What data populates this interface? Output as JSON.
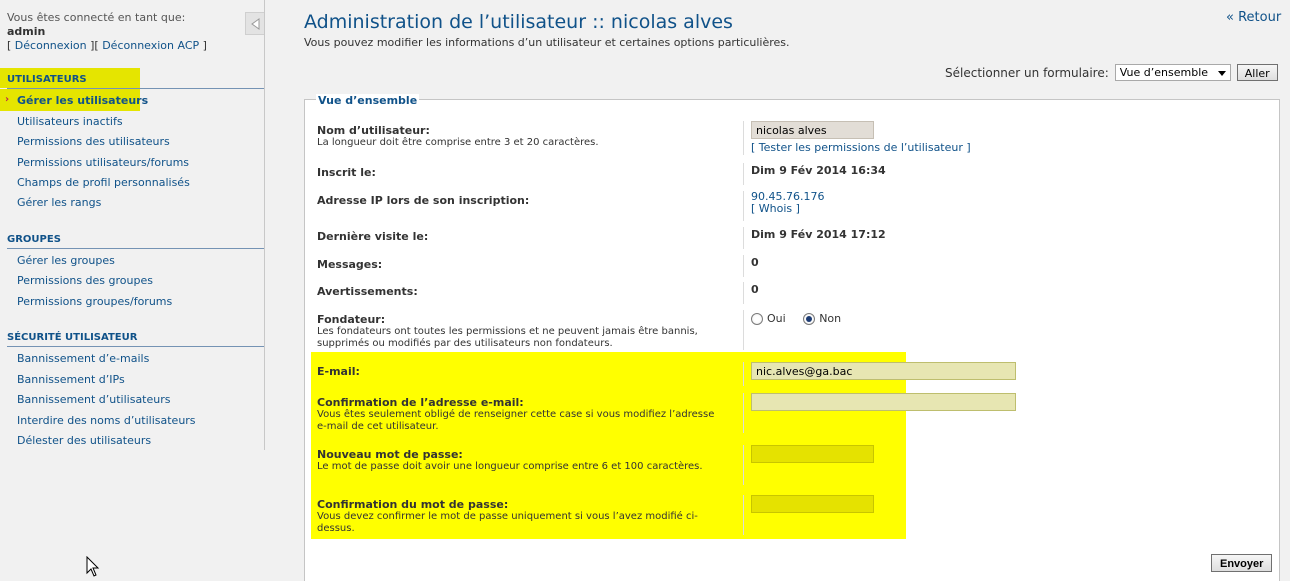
{
  "sidebar": {
    "login_label": "Vous êtes connecté en tant que:",
    "username": "admin",
    "logout": "Déconnexion",
    "logout_acp": "Déconnexion ACP",
    "bracket_open": "[",
    "bracket_mid": "][",
    "bracket_close": "]",
    "sections": [
      {
        "title": "UTILISATEURS",
        "items": [
          "Gérer les utilisateurs",
          "Utilisateurs inactifs",
          "Permissions des utilisateurs",
          "Permissions utilisateurs/forums",
          "Champs de profil personnalisés",
          "Gérer les rangs"
        ]
      },
      {
        "title": "GROUPES",
        "items": [
          "Gérer les groupes",
          "Permissions des groupes",
          "Permissions groupes/forums"
        ]
      },
      {
        "title": "SÉCURITÉ UTILISATEUR",
        "items": [
          "Bannissement d’e-mails",
          "Bannissement d’IPs",
          "Bannissement d’utilisateurs",
          "Interdire des noms d’utilisateurs",
          "Délester des utilisateurs"
        ]
      }
    ],
    "active_arrow": "›"
  },
  "header": {
    "title": "Administration de l’utilisateur :: nicolas alves",
    "description": "Vous pouvez modifier les informations d’un utilisateur et certaines options particulières.",
    "back": "« Retour"
  },
  "form_selector": {
    "label": "Sélectionner un formulaire:",
    "selected": "Vue d’ensemble",
    "button": "Aller"
  },
  "panel": {
    "legend": "Vue d’ensemble",
    "rows": {
      "username": {
        "title": "Nom d’utilisateur:",
        "desc": "La longueur doit être comprise entre 3 et 20 caractères.",
        "value": "nicolas alves",
        "link": "[ Tester les permissions de l’utilisateur ]"
      },
      "registered": {
        "title": "Inscrit le:",
        "value": "Dim 9 Fév 2014 16:34"
      },
      "ip": {
        "title": "Adresse IP lors de son inscription:",
        "value": "90.45.76.176",
        "link": "[ Whois ]"
      },
      "last_visit": {
        "title": "Dernière visite le:",
        "value": "Dim 9 Fév 2014 17:12"
      },
      "posts": {
        "title": "Messages:",
        "value": "0"
      },
      "warnings": {
        "title": "Avertissements:",
        "value": "0"
      },
      "founder": {
        "title": "Fondateur:",
        "desc": "Les fondateurs ont toutes les permissions et ne peuvent jamais être bannis, supprimés ou modifiés par des utilisateurs non fondateurs.",
        "option_yes": "Oui",
        "option_no": "Non",
        "selected": "Non"
      },
      "email": {
        "title": "E-mail:",
        "value": "nic.alves@ga.bac"
      },
      "email_confirm": {
        "title": "Confirmation de l’adresse e-mail:",
        "desc": "Vous êtes seulement obligé de renseigner cette case si vous modifiez l’adresse e-mail de cet utilisateur.",
        "value": ""
      },
      "new_password": {
        "title": "Nouveau mot de passe:",
        "desc": "Le mot de passe doit avoir une longueur comprise entre 6 et 100 caractères.",
        "value": ""
      },
      "password_confirm": {
        "title": "Confirmation du mot de passe:",
        "desc": "Vous devez confirmer le mot de passe uniquement si vous l’avez modifié ci-dessus.",
        "value": ""
      }
    },
    "submit": "Envoyer"
  },
  "colors": {
    "link": "#105289",
    "highlight": "#ffff00",
    "menu_highlight": "#e5e500"
  }
}
